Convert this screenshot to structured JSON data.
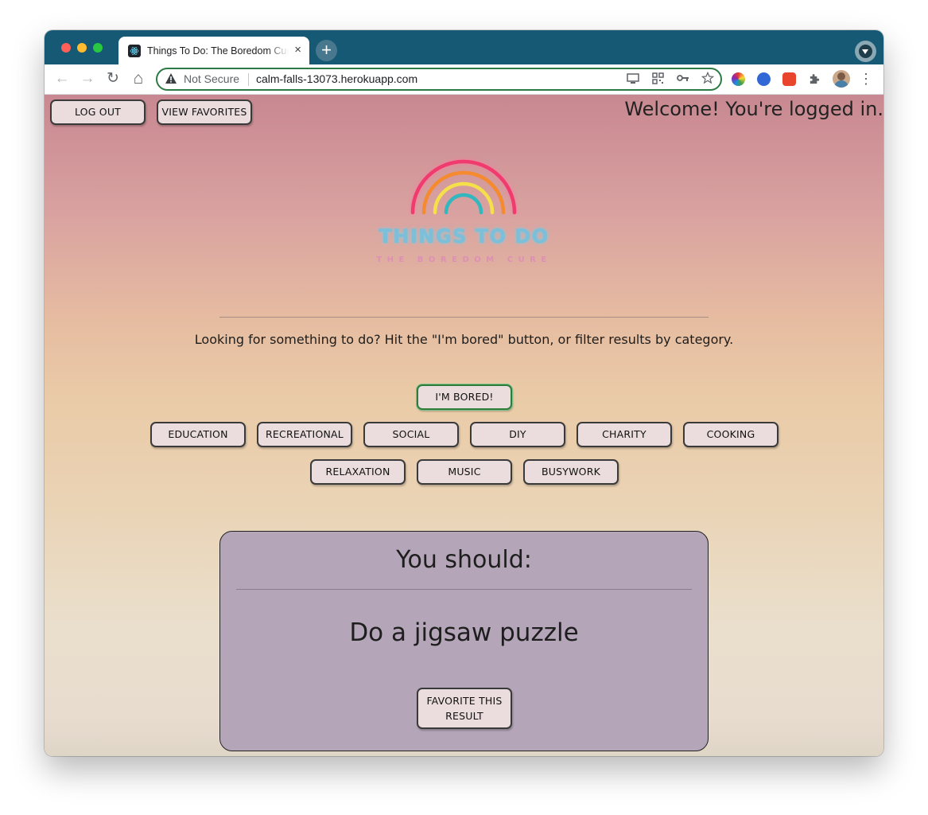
{
  "browser": {
    "tab_title": "Things To Do: The Boredom Cure",
    "tab_close": "×",
    "new_tab": "+",
    "security_label": "Not Secure",
    "url": "calm-falls-13073.herokuapp.com",
    "nav": {
      "back": "←",
      "forward": "→",
      "reload": "↻",
      "home": "⌂"
    },
    "menu": "⋮"
  },
  "header": {
    "logout_label": "LOG OUT",
    "favorites_label": "VIEW FAVORITES",
    "welcome": "Welcome! You're logged in."
  },
  "logo": {
    "title": "THINGS TO DO",
    "subtitle": "THE BOREDOM CURE",
    "arc_colors": [
      "#f03b6e",
      "#f58a2e",
      "#f5e04a",
      "#33b7bf"
    ]
  },
  "intro_text": "Looking for something to do? Hit the \"I'm bored\" button, or filter results by category.",
  "bored_label": "I'M BORED!",
  "categories_row1": [
    "EDUCATION",
    "RECREATIONAL",
    "SOCIAL",
    "DIY",
    "CHARITY",
    "COOKING"
  ],
  "categories_row2": [
    "RELAXATION",
    "MUSIC",
    "BUSYWORK"
  ],
  "result": {
    "heading": "You should:",
    "activity": "Do a jigsaw puzzle",
    "favorite_line1": "FAVORITE THIS",
    "favorite_line2": "RESULT"
  },
  "colors": {
    "titlebar": "#165974",
    "omnibox_border": "#2c7a45",
    "bored_border": "#2e7d3a",
    "card_bg": "#b4a6b8"
  }
}
